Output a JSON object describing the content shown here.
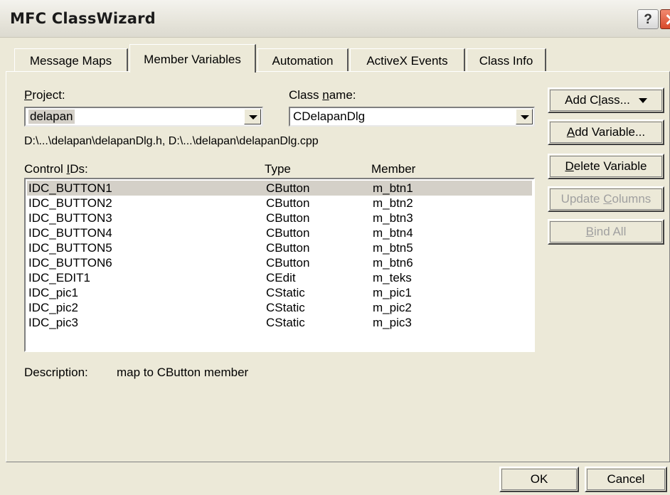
{
  "window": {
    "title": "MFC ClassWizard",
    "help_glyph": "?"
  },
  "tabs": [
    "Message Maps",
    "Member Variables",
    "Automation",
    "ActiveX Events",
    "Class Info"
  ],
  "active_tab": "Member Variables",
  "project": {
    "label_prefix": "",
    "label_ul": "P",
    "label_rest": "roject:",
    "value": "delapan"
  },
  "class_name": {
    "label_prefix": "Class ",
    "label_ul": "n",
    "label_rest": "ame:",
    "value": "CDelapanDlg"
  },
  "files_path": "D:\\...\\delapan\\delapanDlg.h, D:\\...\\delapan\\delapanDlg.cpp",
  "columns": {
    "control_ids_prefix": "Control ",
    "control_ids_ul": "I",
    "control_ids_rest": "Ds:",
    "type": "Type",
    "member": "Member"
  },
  "rows": [
    {
      "id": "IDC_BUTTON1",
      "type": "CButton",
      "member": "m_btn1"
    },
    {
      "id": "IDC_BUTTON2",
      "type": "CButton",
      "member": "m_btn2"
    },
    {
      "id": "IDC_BUTTON3",
      "type": "CButton",
      "member": "m_btn3"
    },
    {
      "id": "IDC_BUTTON4",
      "type": "CButton",
      "member": "m_btn4"
    },
    {
      "id": "IDC_BUTTON5",
      "type": "CButton",
      "member": "m_btn5"
    },
    {
      "id": "IDC_BUTTON6",
      "type": "CButton",
      "member": "m_btn6"
    },
    {
      "id": "IDC_EDIT1",
      "type": "CEdit",
      "member": "m_teks"
    },
    {
      "id": "IDC_pic1",
      "type": "CStatic",
      "member": "m_pic1"
    },
    {
      "id": "IDC_pic2",
      "type": "CStatic",
      "member": "m_pic2"
    },
    {
      "id": "IDC_pic3",
      "type": "CStatic",
      "member": "m_pic3"
    }
  ],
  "selected_row": "IDC_BUTTON1",
  "description": {
    "label": "Description:",
    "value": "map to CButton member"
  },
  "buttons": {
    "add_class": {
      "prefix": "Add C",
      "ul": "l",
      "rest": "ass..."
    },
    "add_variable": {
      "prefix": "",
      "ul": "A",
      "rest": "dd Variable..."
    },
    "delete_variable": {
      "prefix": "",
      "ul": "D",
      "rest": "elete Variable"
    },
    "update_columns": {
      "prefix": "Update ",
      "ul": "C",
      "rest": "olumns"
    },
    "bind_all": {
      "prefix": "",
      "ul": "B",
      "rest": "ind All"
    },
    "ok": "OK",
    "cancel": "Cancel"
  }
}
